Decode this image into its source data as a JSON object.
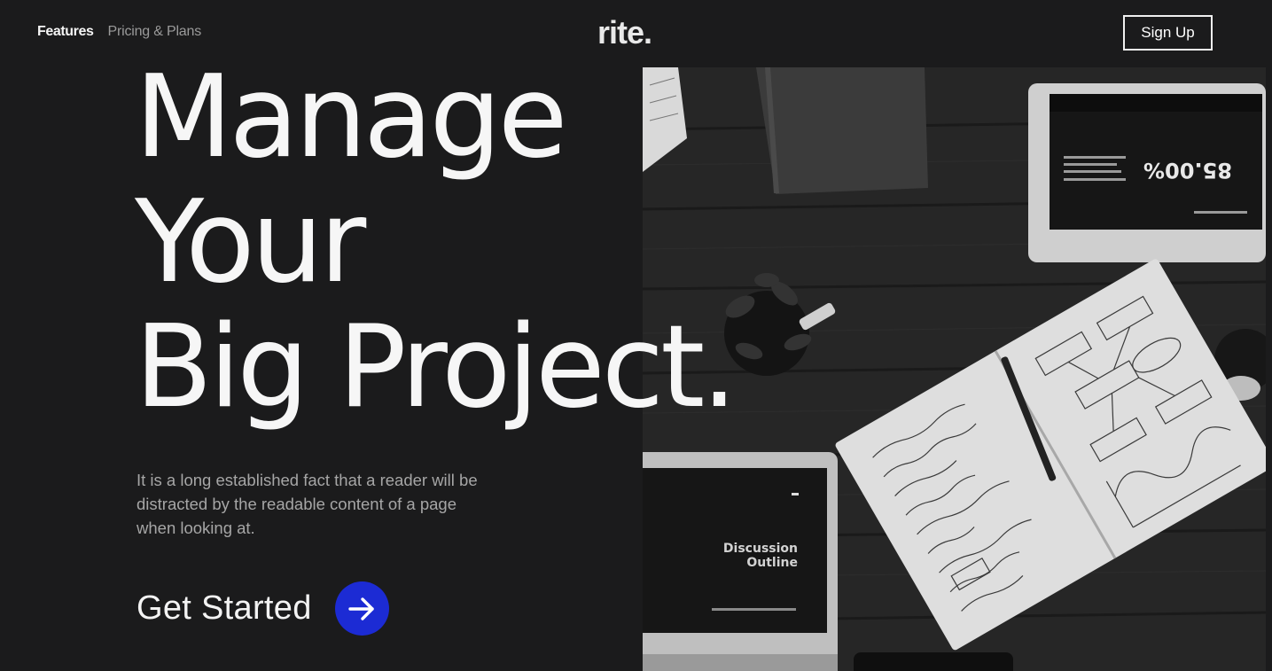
{
  "nav": {
    "links": [
      {
        "label": "Features",
        "active": true
      },
      {
        "label": "Pricing & Plans",
        "active": false
      }
    ],
    "logo": "rite.",
    "signup_label": "Sign Up"
  },
  "hero": {
    "headline_lines": [
      "Manage",
      "Your",
      "Big Project."
    ],
    "lede": "It is a long established fact that a reader will be distracted by the readable content of a page when looking at.",
    "cta_label": "Get Started",
    "cta_icon": "arrow-right-icon",
    "accent_color": "#1c2bd4"
  },
  "photo": {
    "tablet_stat": "85.00%",
    "laptop_title_1": "Discussion",
    "laptop_title_2": "Outline"
  }
}
